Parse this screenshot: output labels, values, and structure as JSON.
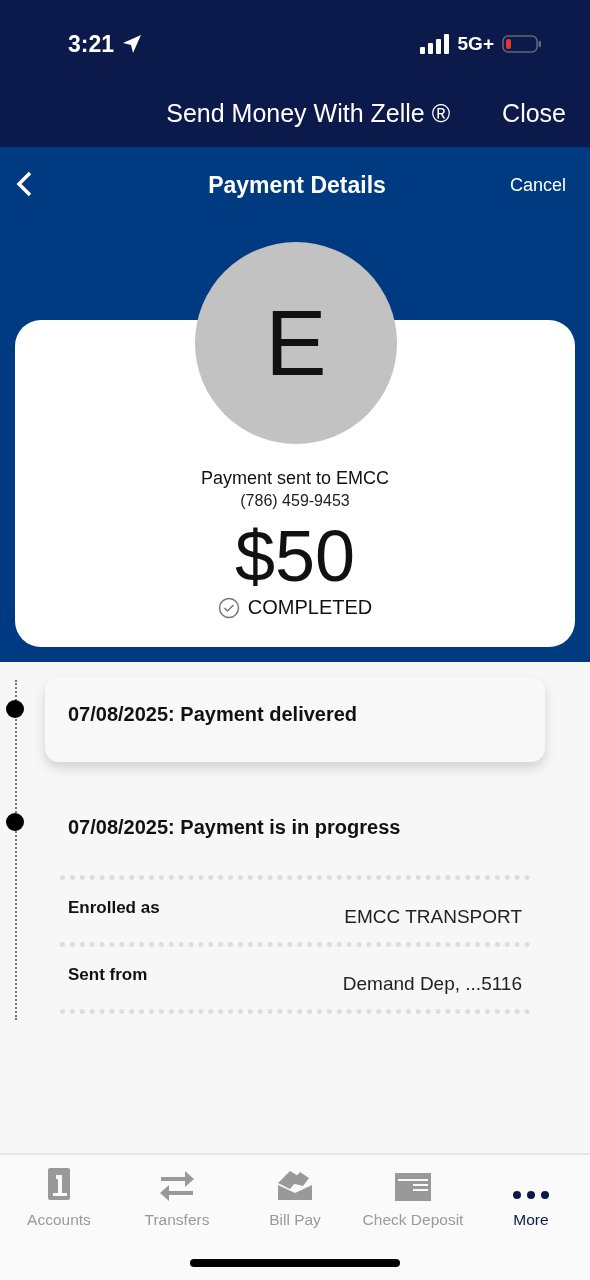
{
  "status_bar": {
    "time": "3:21",
    "network": "5G+"
  },
  "top_bar": {
    "title": "Send Money With Zelle ®",
    "close": "Close"
  },
  "nav_bar": {
    "title": "Payment Details",
    "cancel": "Cancel"
  },
  "payment": {
    "initial": "E",
    "recipient": "Payment sent to EMCC",
    "phone": "(786) 459-9453",
    "amount": "$50",
    "status": "COMPLETED"
  },
  "timeline": [
    {
      "text": "07/08/2025: Payment delivered",
      "highlighted": true
    },
    {
      "text": "07/08/2025: Payment is in progress",
      "highlighted": false
    }
  ],
  "details": [
    {
      "label": "Enrolled as",
      "value": "EMCC TRANSPORT"
    },
    {
      "label": "Sent from",
      "value": "Demand Dep, ...5116"
    }
  ],
  "tabs": [
    {
      "label": "Accounts",
      "kind": "accounts",
      "selected": false
    },
    {
      "label": "Transfers",
      "kind": "transfers",
      "selected": false
    },
    {
      "label": "Bill Pay",
      "kind": "billpay",
      "selected": false
    },
    {
      "label": "Check Deposit",
      "kind": "check",
      "selected": false
    },
    {
      "label": "More",
      "kind": "more",
      "selected": true
    }
  ]
}
